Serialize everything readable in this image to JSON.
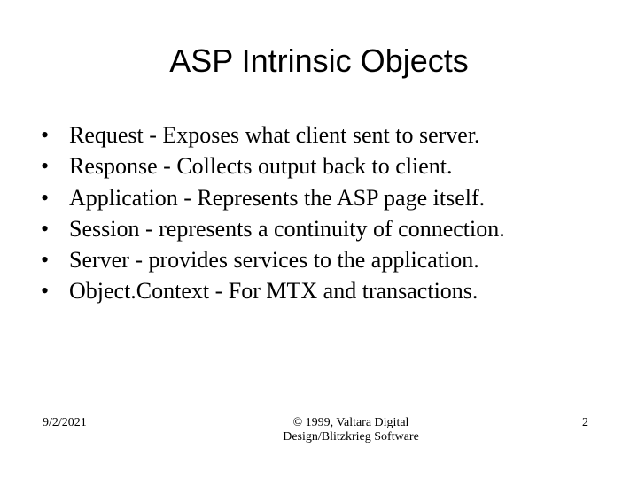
{
  "title": "ASP Intrinsic Objects",
  "bullets": [
    "Request - Exposes what client sent to server.",
    "Response - Collects output back to client.",
    "Application - Represents the ASP page itself.",
    "Session - represents a continuity of connection.",
    "Server - provides services to the application.",
    "Object.Context - For MTX and transactions."
  ],
  "footer": {
    "date": "9/2/2021",
    "copyright_line1": "© 1999, Valtara Digital",
    "copyright_line2": "Design/Blitzkrieg Software",
    "page": "2"
  }
}
